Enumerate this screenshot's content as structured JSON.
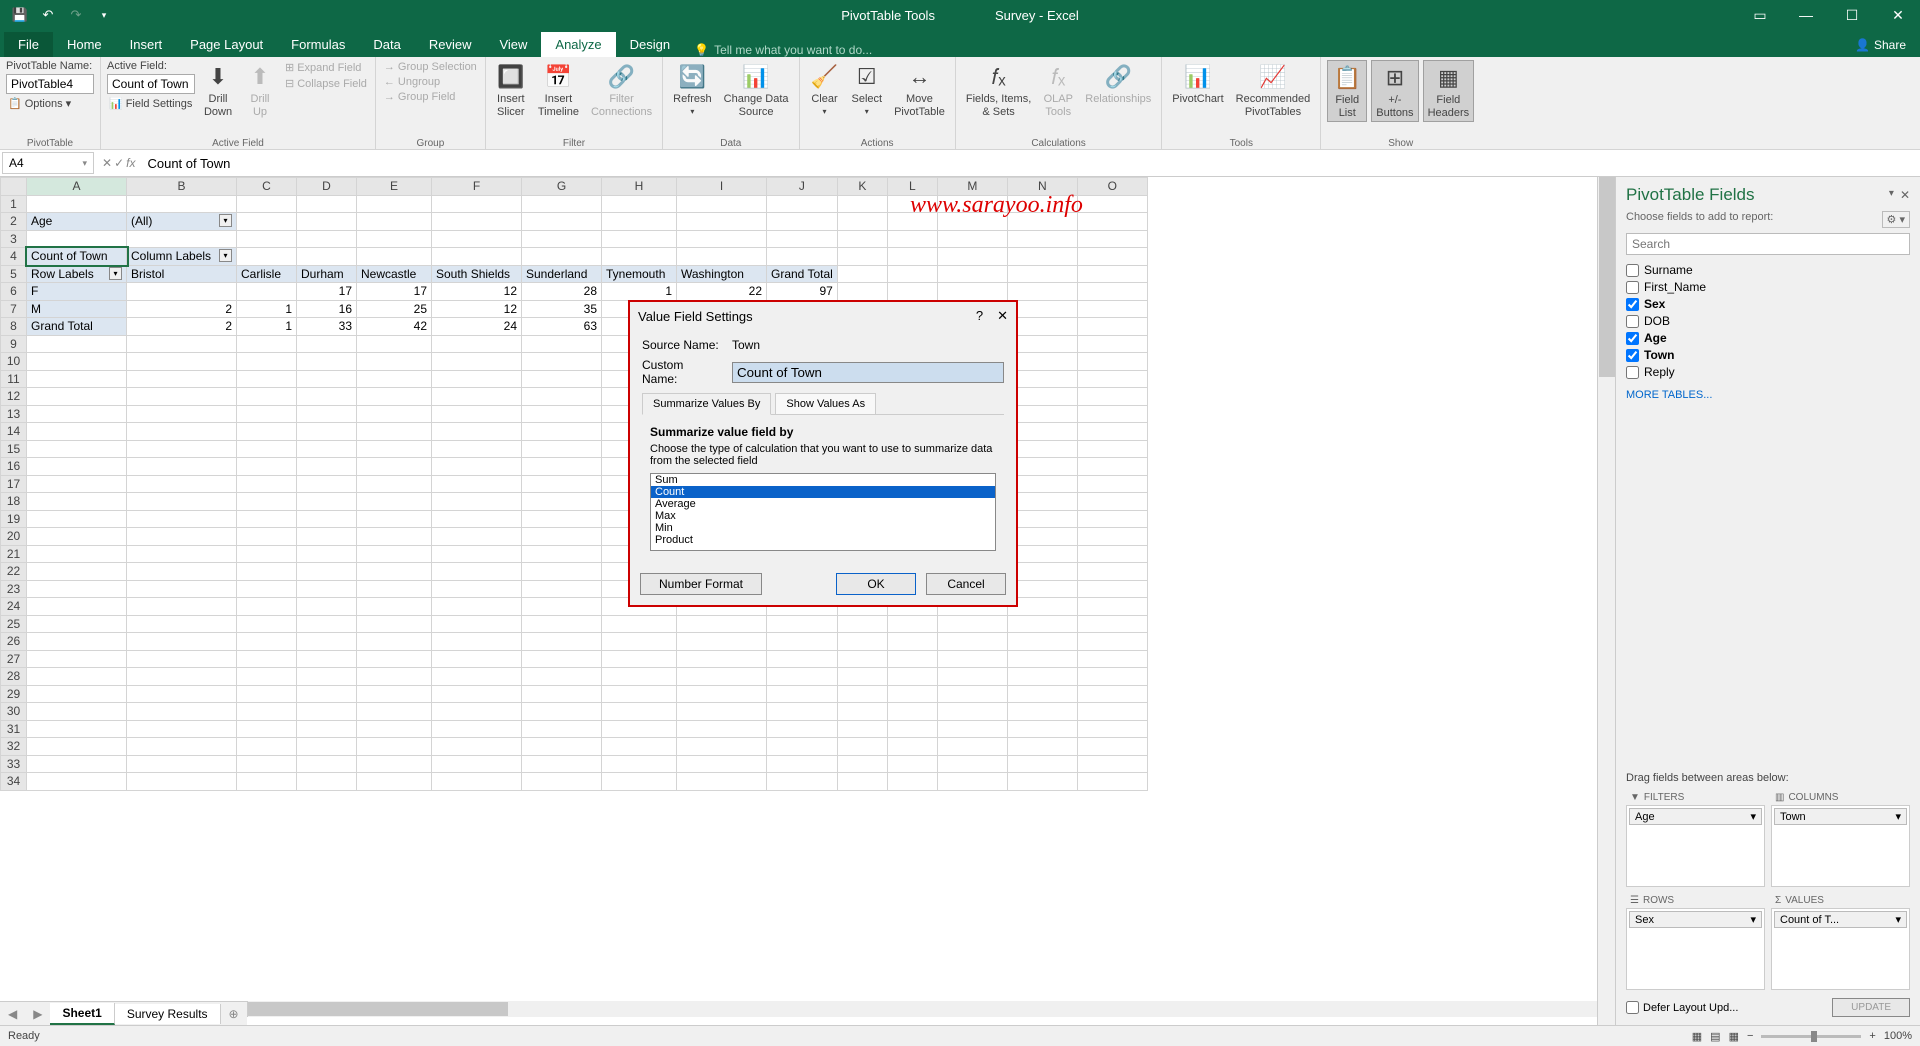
{
  "title": {
    "tools": "PivotTable Tools",
    "doc": "Survey - Excel"
  },
  "tabs": [
    "File",
    "Home",
    "Insert",
    "Page Layout",
    "Formulas",
    "Data",
    "Review",
    "View",
    "Analyze",
    "Design"
  ],
  "tellme": "Tell me what you want to do...",
  "share": "Share",
  "ribbon": {
    "pt_name_label": "PivotTable Name:",
    "pt_name": "PivotTable4",
    "options": "Options",
    "g_pivottable": "PivotTable",
    "active_label": "Active Field:",
    "active_field": "Count of Town",
    "field_settings": "Field Settings",
    "drill_down": "Drill\nDown",
    "drill_up": "Drill\nUp",
    "expand": "Expand Field",
    "collapse": "Collapse Field",
    "g_active": "Active Field",
    "grp_sel": "Group Selection",
    "ungroup": "Ungroup",
    "grp_field": "Group Field",
    "g_group": "Group",
    "slicer": "Insert\nSlicer",
    "timeline": "Insert\nTimeline",
    "filter_conn": "Filter\nConnections",
    "g_filter": "Filter",
    "refresh": "Refresh",
    "change_data": "Change Data\nSource",
    "g_data": "Data",
    "clear": "Clear",
    "select": "Select",
    "move": "Move\nPivotTable",
    "g_actions": "Actions",
    "fields_items": "Fields, Items,\n& Sets",
    "olap": "OLAP\nTools",
    "relationships": "Relationships",
    "g_calc": "Calculations",
    "pivotchart": "PivotChart",
    "recommended": "Recommended\nPivotTables",
    "g_tools": "Tools",
    "field_list": "Field\nList",
    "pm_buttons": "+/-\nButtons",
    "field_headers": "Field\nHeaders",
    "g_show": "Show"
  },
  "namebox": "A4",
  "formula": "Count of Town",
  "columns": [
    "A",
    "B",
    "C",
    "D",
    "E",
    "F",
    "G",
    "H",
    "I",
    "J",
    "K",
    "L",
    "M",
    "N",
    "O"
  ],
  "pivot": {
    "filter_field": "Age",
    "filter_value": "(All)",
    "data_label": "Count of Town",
    "col_label": "Column Labels",
    "row_label": "Row Labels",
    "col_headers": [
      "Bristol",
      "Carlisle",
      "Durham",
      "Newcastle",
      "South Shields",
      "Sunderland",
      "Tynemouth",
      "Washington",
      "Grand Total"
    ],
    "rows": [
      {
        "label": "F",
        "vals": [
          "",
          "",
          "17",
          "17",
          "12",
          "28",
          "1",
          "22",
          "97"
        ]
      },
      {
        "label": "M",
        "vals": [
          "2",
          "1",
          "16",
          "25",
          "12",
          "35",
          "",
          "",
          "*"
        ]
      },
      {
        "label": "Grand Total",
        "vals": [
          "2",
          "1",
          "33",
          "42",
          "24",
          "63",
          "",
          "",
          "*"
        ]
      }
    ]
  },
  "watermark": "www.sarayoo.info",
  "dialog": {
    "title": "Value Field Settings",
    "source_label": "Source Name:",
    "source": "Town",
    "custom_label": "Custom Name:",
    "custom": "Count of Town",
    "tab1": "Summarize Values By",
    "tab2": "Show Values As",
    "section": "Summarize value field by",
    "desc": "Choose the type of calculation that you want to use to summarize data from the selected field",
    "options": [
      "Sum",
      "Count",
      "Average",
      "Max",
      "Min",
      "Product"
    ],
    "number_format": "Number Format",
    "ok": "OK",
    "cancel": "Cancel"
  },
  "fields_pane": {
    "title": "PivotTable Fields",
    "sub": "Choose fields to add to report:",
    "search": "Search",
    "fields": [
      {
        "name": "Surname",
        "checked": false
      },
      {
        "name": "First_Name",
        "checked": false
      },
      {
        "name": "Sex",
        "checked": true
      },
      {
        "name": "DOB",
        "checked": false
      },
      {
        "name": "Age",
        "checked": true
      },
      {
        "name": "Town",
        "checked": true
      },
      {
        "name": "Reply",
        "checked": false
      }
    ],
    "more_tables": "MORE TABLES...",
    "drag_label": "Drag fields between areas below:",
    "areas": {
      "filters": "FILTERS",
      "columns": "COLUMNS",
      "rows": "ROWS",
      "values": "VALUES",
      "filter_chip": "Age",
      "column_chip": "Town",
      "row_chip": "Sex",
      "value_chip": "Count of T..."
    },
    "defer": "Defer Layout Upd...",
    "update": "UPDATE"
  },
  "sheets": [
    "Sheet1",
    "Survey Results"
  ],
  "status": {
    "ready": "Ready",
    "zoom": "100%"
  }
}
